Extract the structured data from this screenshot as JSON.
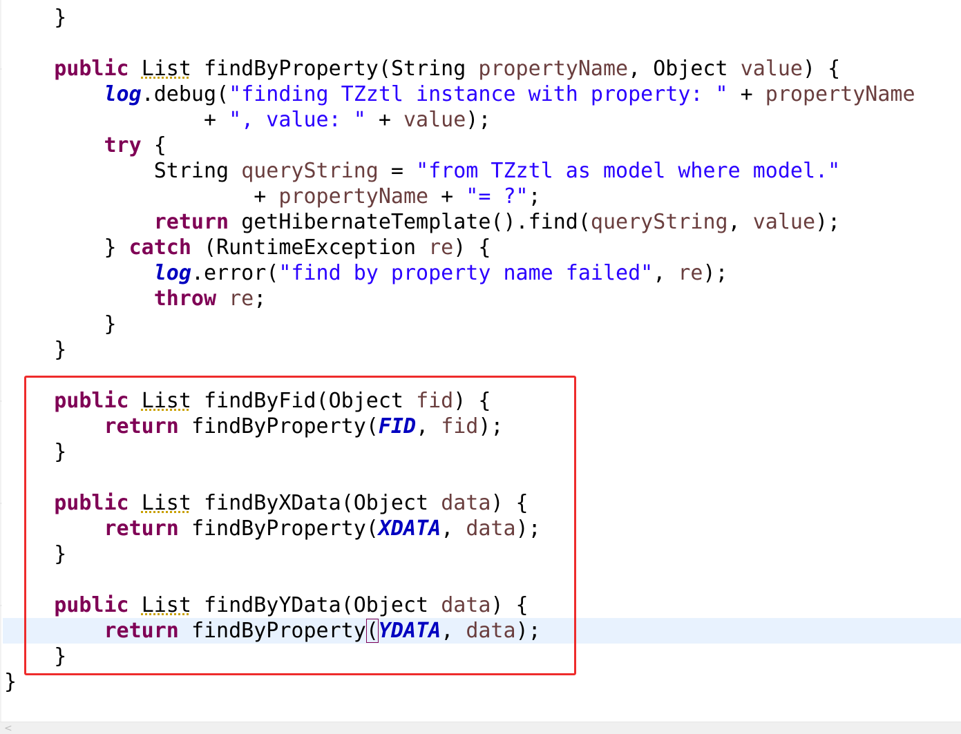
{
  "editor": {
    "lines": [
      {
        "id": "l0",
        "text": "    }"
      },
      {
        "id": "l1",
        "text": ""
      },
      {
        "id": "l2",
        "tokens": [
          "public",
          "List",
          "findByProperty(String",
          "propertyName",
          "Object",
          "value"
        ]
      },
      {
        "id": "l3"
      },
      {
        "id": "l4"
      },
      {
        "id": "l5"
      },
      {
        "id": "l6"
      },
      {
        "id": "l7"
      },
      {
        "id": "l8"
      },
      {
        "id": "l9"
      },
      {
        "id": "l10"
      },
      {
        "id": "l11"
      },
      {
        "id": "l12"
      },
      {
        "id": "l13"
      }
    ],
    "code": {
      "public": "public",
      "list": "List",
      "try": "try",
      "catch": "catch",
      "return": "return",
      "throw": "throw",
      "m_findByProperty": "findByProperty",
      "m_findByFid": "findByFid",
      "m_findByXData": "findByXData",
      "m_findByYData": "findByYData",
      "t_string": "String",
      "t_object": "Object",
      "t_runtime": "RuntimeException",
      "v_propertyName": "propertyName",
      "v_value": "value",
      "v_queryString": "queryString",
      "v_re": "re",
      "v_fid": "fid",
      "v_data": "data",
      "f_log": "log",
      "f_FID": "FID",
      "f_XDATA": "XDATA",
      "f_YDATA": "YDATA",
      "m_debug": "debug",
      "m_error": "error",
      "m_getHibernateTemplate": "getHibernateTemplate",
      "m_find": "find",
      "s_finding": "\"finding TZztl instance with property: \"",
      "s_value": "\", value: \"",
      "s_from": "\"from TZztl as model where model.\"",
      "s_eq": "\"= ?\"",
      "s_failed": "\"find by property name failed\""
    }
  },
  "colors": {
    "keyword": "#7f0055",
    "string": "#2a00ff",
    "local_variable": "#6a3e3e",
    "field": "#0000c0",
    "highlight_box": "#ee2b2b",
    "current_line": "#e8f2fe"
  }
}
